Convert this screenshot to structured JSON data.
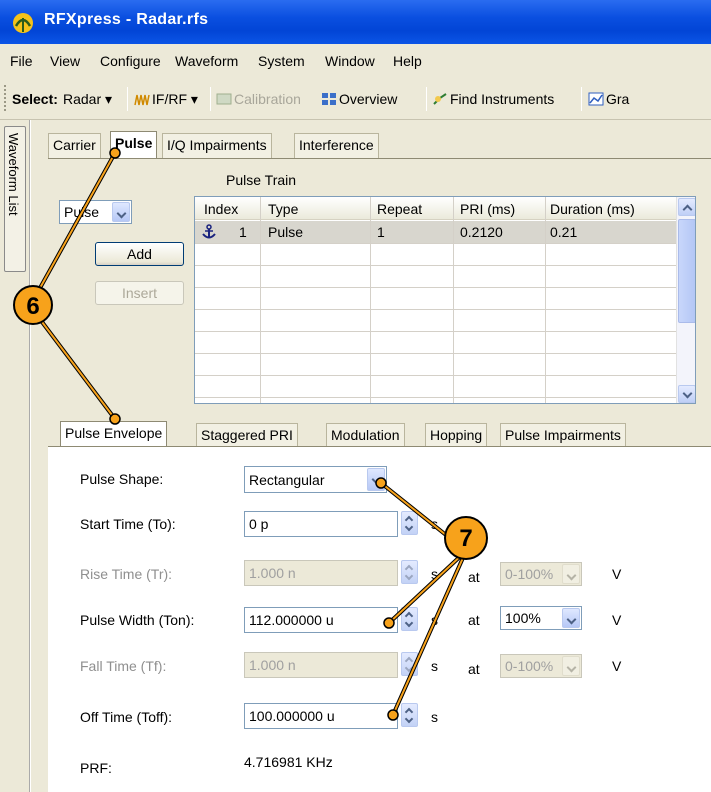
{
  "window": {
    "title": "RFXpress - Radar.rfs"
  },
  "menu": [
    "File",
    "View",
    "Configure",
    "Waveform",
    "System",
    "Window",
    "Help"
  ],
  "toolbar": {
    "select_label": "Select:",
    "select_value": "Radar",
    "ifrf": "IF/RF",
    "calibration": "Calibration",
    "overview": "Overview",
    "find_instruments": "Find Instruments",
    "graph": "Gra"
  },
  "side_tab": "Waveform List",
  "top_tabs": [
    "Carrier",
    "Pulse",
    "I/Q Impairments",
    "Interference"
  ],
  "pulse_train": {
    "title": "Pulse Train",
    "type_combo": "Pulse",
    "add_label": "Add",
    "insert_label": "Insert",
    "columns": [
      "Index",
      "Type",
      "Repeat",
      "PRI (ms)",
      "Duration (ms)"
    ],
    "rows": [
      {
        "index": "1",
        "type": "Pulse",
        "repeat": "1",
        "pri": "0.2120",
        "duration": "0.21"
      }
    ]
  },
  "lower_tabs": [
    "Pulse Envelope",
    "Staggered PRI",
    "Modulation",
    "Hopping",
    "Pulse Impairments"
  ],
  "envelope": {
    "pulse_shape_label": "Pulse Shape:",
    "pulse_shape_value": "Rectangular",
    "start_label": "Start Time (To):",
    "start_value": "0 p",
    "rise_label": "Rise Time (Tr):",
    "rise_value": "1.000 n",
    "width_label": "Pulse Width (Ton):",
    "width_value": "112.000000 u",
    "fall_label": "Fall Time (Tf):",
    "fall_value": "1.000 n",
    "off_label": "Off Time (Toff):",
    "off_value": "100.000000 u",
    "prf_label": "PRF:",
    "prf_value": "4.716981 KHz",
    "unit_s": "s",
    "at": "at",
    "unit_v": "V",
    "rise_range": "0-100%",
    "width_range": "100%",
    "fall_range": "0-100%"
  },
  "callouts": [
    "6",
    "7"
  ],
  "colors": {
    "title_bar": "#0a4fe0",
    "callout": "#f7a21b",
    "panel": "#ece9d8"
  }
}
